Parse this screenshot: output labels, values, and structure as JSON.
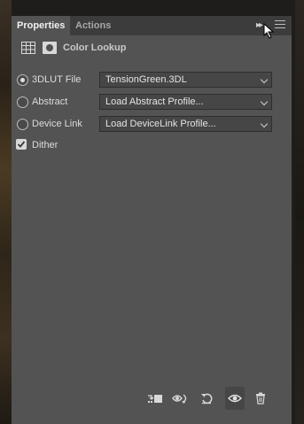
{
  "tabs": [
    {
      "label": "Properties",
      "active": true
    },
    {
      "label": "Actions",
      "active": false
    }
  ],
  "panel": {
    "title": "Color Lookup"
  },
  "options": [
    {
      "label": "3DLUT File",
      "selected": true,
      "value": "TensionGreen.3DL"
    },
    {
      "label": "Abstract",
      "selected": false,
      "value": "Load Abstract Profile..."
    },
    {
      "label": "Device Link",
      "selected": false,
      "value": "Load DeviceLink Profile..."
    }
  ],
  "dither": {
    "label": "Dither",
    "checked": true
  },
  "colors": {
    "panel_bg": "#535353",
    "tab_bar_bg": "#3c3c3c",
    "text": "#dcdcdc"
  },
  "footer_icons": [
    "clip-to-layer-icon",
    "view-previous-state-icon",
    "reset-icon",
    "visibility-eye-icon",
    "trash-icon"
  ]
}
